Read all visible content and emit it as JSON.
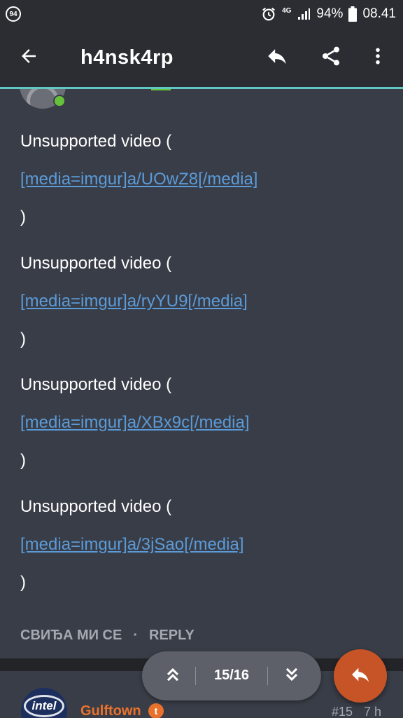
{
  "status_bar": {
    "notification_count": "94",
    "network": "4G",
    "battery": "94%",
    "time": "08.41"
  },
  "toolbar": {
    "title": "h4nsk4rp"
  },
  "post": {
    "blocks": [
      {
        "text": "Unsupported video (",
        "link": "[media=imgur]a/UOwZ8[/media]",
        "close": ")"
      },
      {
        "text": "Unsupported video (",
        "link": "[media=imgur]a/ryYU9[/media]",
        "close": ")"
      },
      {
        "text": "Unsupported video (",
        "link": "[media=imgur]a/XBx9c[/media]",
        "close": ")"
      },
      {
        "text": "Unsupported video (",
        "link": "[media=imgur]a/3jSao[/media]",
        "close": ")"
      }
    ],
    "actions": {
      "like_label": "СВИЂА МИ СЕ",
      "separator": "·",
      "reply_label": "REPLY"
    }
  },
  "next_post": {
    "author": "Gulftown",
    "author_badge": "t",
    "avatar_text": "intel",
    "post_number": "#15",
    "time_ago": "7 h"
  },
  "pager": {
    "label": "15/16"
  },
  "colors": {
    "accent": "#5ec8c1",
    "link": "#5b9bd9",
    "fab": "#c75427",
    "username": "#e8722c",
    "background": "#393d47"
  }
}
